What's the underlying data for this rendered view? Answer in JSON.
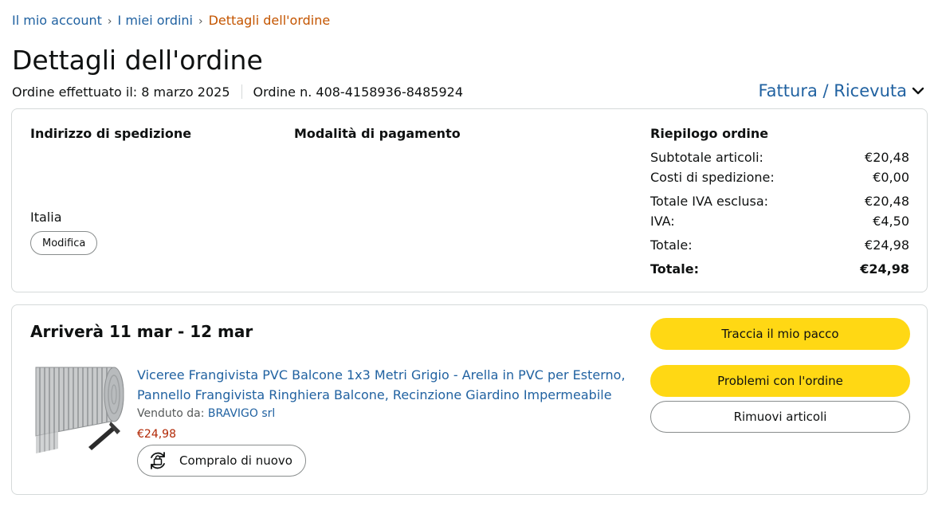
{
  "breadcrumb": {
    "items": [
      "Il mio account",
      "I miei ordini",
      "Dettagli dell'ordine"
    ],
    "separator": "›"
  },
  "page": {
    "title": "Dettagli dell'ordine",
    "order_date": "Ordine effettuato il: 8 marzo 2025",
    "order_number": "Ordine n. 408-4158936-8485924",
    "invoice_link": "Fattura / Ricevuta"
  },
  "shipping": {
    "title": "Indirizzo di spedizione",
    "country": "Italia",
    "edit_label": "Modifica"
  },
  "payment": {
    "title": "Modalità di pagamento"
  },
  "summary": {
    "title": "Riepilogo ordine",
    "rows": [
      {
        "label": "Subtotale articoli:",
        "value": "€20,48"
      },
      {
        "label": "Costi di spedizione:",
        "value": "€0,00"
      },
      {
        "label": "Totale IVA esclusa:",
        "value": "€20,48"
      },
      {
        "label": "IVA:",
        "value": "€4,50"
      },
      {
        "label": "Totale:",
        "value": "€24,98"
      },
      {
        "label": "Totale:",
        "value": "€24,98"
      }
    ]
  },
  "shipment": {
    "arrival": "Arriverà 11 mar - 12 mar",
    "product_title": "Viceree Frangivista PVC Balcone 1x3 Metri Grigio - Arella in PVC per Esterno, Pannello Frangivista Ringhiera Balcone, Recinzione Giardino Impermeabile",
    "sold_by_label": "Venduto da:",
    "seller": "BRAVIGO srl",
    "price": "€24,98",
    "buy_again_label": "Compralo di nuovo",
    "track_label": "Traccia il mio pacco",
    "problem_label": "Problemi con l'ordine",
    "remove_label": "Rimuovi articoli"
  },
  "colors": {
    "link": "#2162a1",
    "breadcrumb_current": "#c45500",
    "price": "#b12704",
    "primary_button": "#ffd814",
    "border": "#d5d9d9"
  },
  "icons": [
    "chevron-down-icon",
    "buy-again-cycle-icon",
    "product-image"
  ]
}
